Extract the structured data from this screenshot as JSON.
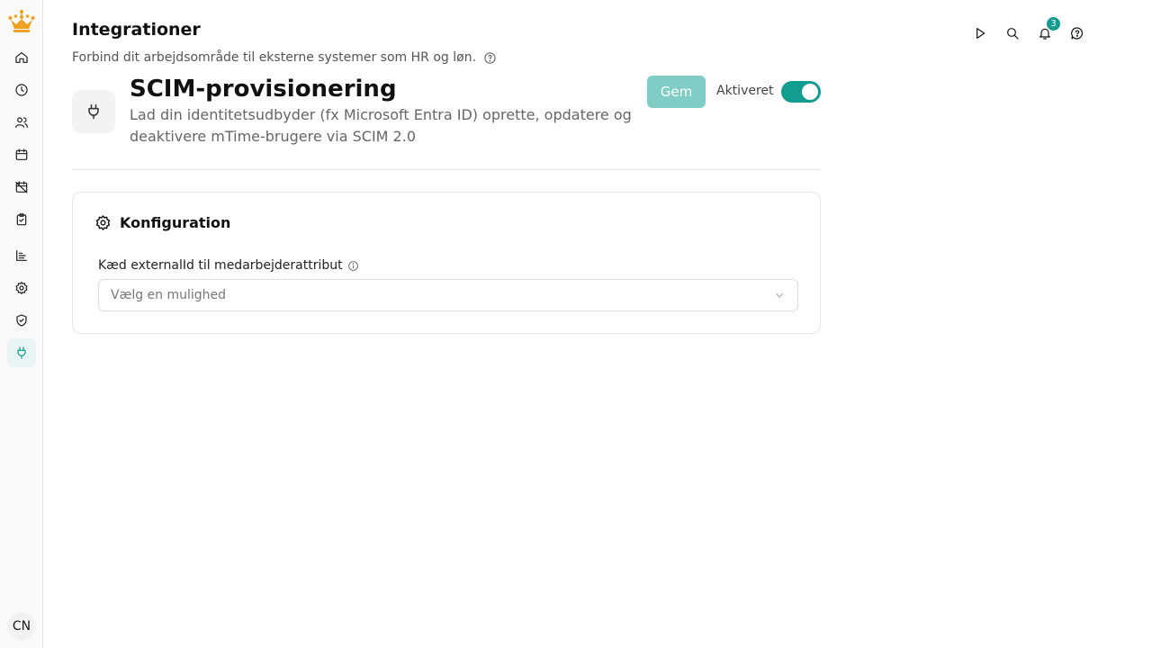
{
  "header": {
    "title": "Integrationer",
    "subtitle": "Forbind dit arbejdsområde til eksterne systemer som HR og løn."
  },
  "topbar": {
    "notifications_count": "3"
  },
  "sidebar": {
    "avatar_initials": "CN",
    "items": [
      {
        "icon": "home-icon"
      },
      {
        "icon": "clock-icon"
      },
      {
        "icon": "users-icon"
      },
      {
        "icon": "calendar-icon"
      },
      {
        "icon": "calendar-off-icon"
      },
      {
        "icon": "clipboard-check-icon"
      },
      {
        "icon": "chart-icon"
      },
      {
        "icon": "gear-icon"
      },
      {
        "icon": "shield-check-icon"
      },
      {
        "icon": "plug-icon",
        "active": true
      }
    ]
  },
  "integration": {
    "title": "SCIM-provisionering",
    "description": "Lad din identitetsudbyder (fx Microsoft Entra ID) oprette, opdatere og deaktivere mTime-brugere via SCIM 2.0",
    "save_label": "Gem",
    "toggle_label": "Aktiveret",
    "enabled": true
  },
  "config": {
    "title": "Konfiguration",
    "field_label": "Kæd externalId til medarbejderattribut",
    "select_placeholder": "Vælg en mulighed"
  },
  "colors": {
    "accent": "#139c90",
    "accent_light": "#7fcdc6",
    "logo": "#f0a020"
  }
}
